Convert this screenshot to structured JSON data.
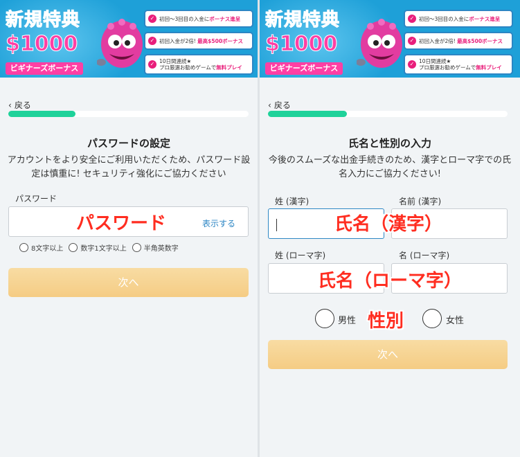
{
  "banner": {
    "title": "新規特典",
    "amount": "$1000",
    "subtitle": "ビギナーズボーナス",
    "items": [
      {
        "pre": "初回〜3回目の入金に",
        "hl": "ボーナス進呈",
        "post": ""
      },
      {
        "pre": "初回入金が2倍! ",
        "hl": "最高$500ボーナス",
        "post": ""
      },
      {
        "line1": "10日間連続★",
        "pre": "プロ厳選お勧めゲームで",
        "hl": "無料プレイ",
        "post": ""
      }
    ]
  },
  "left": {
    "back": "戻る",
    "progress": 0.28,
    "title": "パスワードの設定",
    "description": "アカウントをより安全にご利用いただくため、パスワード設定は慎重に! セキュリティ強化にご協力ください",
    "password_label": "パスワード",
    "password_overlay": "パスワード",
    "show_button": "表示する",
    "requirements": [
      "8文字以上",
      "数字1文字以上",
      "半角英数字"
    ],
    "next_button": "次へ"
  },
  "right": {
    "back": "戻る",
    "progress": 0.33,
    "title": "氏名と性別の入力",
    "description": "今後のスムーズな出金手続きのため、漢字とローマ字での氏名入力にご協力ください!",
    "last_kanji_label": "姓 (漢字)",
    "first_kanji_label": "名前 (漢字)",
    "kanji_overlay": "氏名（漢字）",
    "last_roman_label": "姓 (ローマ字)",
    "first_roman_label": "名 (ローマ字)",
    "roman_overlay": "氏名（ローマ字）",
    "male_label": "男性",
    "female_label": "女性",
    "gender_overlay": "性別",
    "next_button": "次へ"
  },
  "colors": {
    "banner_blue": "#1ea0d8",
    "promo_pink": "#ff3fa4",
    "progress_green": "#1fd29a",
    "link_blue": "#2c86c4",
    "button_gold": "#f5cc84",
    "overlay_red": "#ff2d20"
  },
  "icons": {
    "back": "chevron-left-icon",
    "check": "check-circle-icon",
    "mascot": "pink-monster-mascot-icon"
  }
}
